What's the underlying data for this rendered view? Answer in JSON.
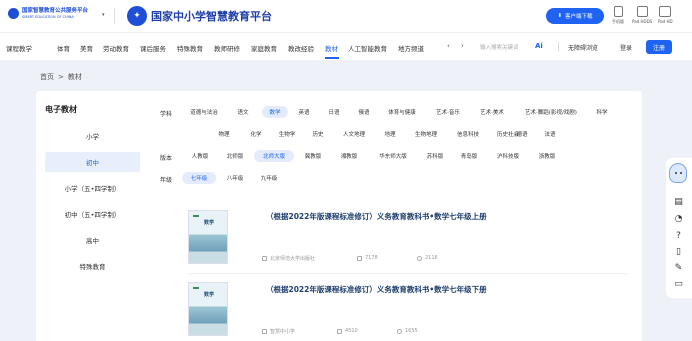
{
  "header": {
    "logo_small_cn": "国家智慧教育公共服务平台",
    "logo_small_en": "SMART EDUCATION OF CHINA",
    "logo_main": "国家中小学智慧教育平台",
    "download_label": "客户端下载",
    "devices": [
      "手机版",
      "Pad HDDS",
      "Pad HD"
    ]
  },
  "nav": {
    "items": [
      "课程教学",
      "体育",
      "美育",
      "劳动教育",
      "课后服务",
      "特殊教育",
      "教师研修",
      "家庭教育",
      "教改经验",
      "教材",
      "人工智能教育",
      "地方频道"
    ],
    "active": "教材",
    "search_placeholder": "输入搜索关键词",
    "ai_label": "Ai",
    "barrier_free": "无障碍浏览",
    "login": "登录",
    "register": "注册"
  },
  "breadcrumb": [
    "首页",
    "教材"
  ],
  "sidebar": {
    "title": "电子教材",
    "items": [
      "小学",
      "初中",
      "小学（五•四学制）",
      "初中（五•四学制）",
      "高中",
      "特殊教育"
    ],
    "active": "初中"
  },
  "filters": {
    "subject_label": "学科",
    "subjects_row1": [
      "道德与法治",
      "语文",
      "数学",
      "英语",
      "日语",
      "俄语",
      "体育与健康",
      "艺术·音乐",
      "艺术·美术",
      "艺术·舞蹈(影视/戏剧)",
      "科学"
    ],
    "subjects_row2": [
      "物理",
      "化学",
      "生物学",
      "历史",
      "人文地理",
      "地理",
      "生物地理",
      "信息科技",
      "历史社会",
      "德语",
      "法语"
    ],
    "subject_active": "数学",
    "version_label": "版本",
    "versions": [
      "人教版",
      "北师版",
      "北师大版",
      "冀教版",
      "湘教版",
      "华东师大版",
      "苏科版",
      "青岛版",
      "沪科技版",
      "浙教版"
    ],
    "version_active": "北师大版",
    "grade_label": "年级",
    "grades": [
      "七年级",
      "八年级",
      "九年级"
    ],
    "grade_active": "七年级"
  },
  "books": [
    {
      "title": "（根据2022年版课程标准修订）义务教育教科书•数学七年级上册",
      "cover_subject": "数学",
      "publisher": "北京师范大学出版社",
      "views": "7178",
      "likes": "2116"
    },
    {
      "title": "（根据2022年版课程标准修订）义务教育教科书•数学七年级下册",
      "cover_subject": "数学",
      "publisher": "智慧中小学",
      "views": "4510",
      "likes": "1655"
    }
  ]
}
